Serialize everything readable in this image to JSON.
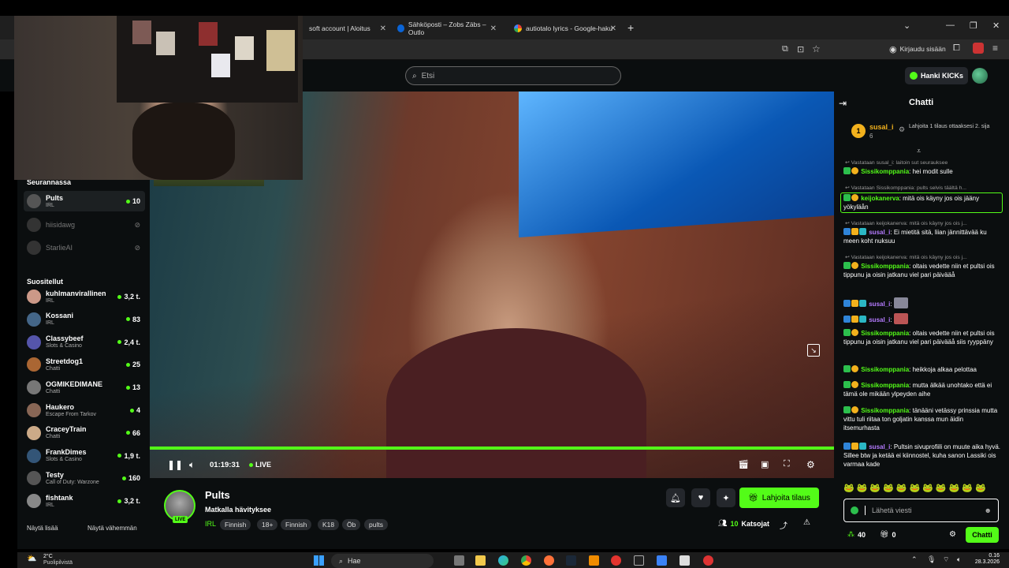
{
  "browser": {
    "tabs": [
      {
        "label": "soft account | Aloitus",
        "favicon_color": "#2b6cb0"
      },
      {
        "label": "Sähköposti – Zobs Zäbs – Outlo",
        "favicon_color": "#0a64d6"
      },
      {
        "label": "autiotalo lyrics - Google-haku",
        "favicon_color": "#ea4335"
      }
    ],
    "new_tab": "+",
    "controls": {
      "minimize": "—",
      "maximize": "❐",
      "close": "✕",
      "dropdown": "⌄"
    },
    "signin_label": "Kirjaudu sisään"
  },
  "header": {
    "search_placeholder": "Etsi",
    "kicks_button": "Hanki KICKs"
  },
  "sidebar": {
    "following_title": "Seurannassa",
    "following": [
      {
        "name": "Pults",
        "category": "IRL",
        "viewers": "10",
        "live": true
      },
      {
        "name": "hiisidawg",
        "category": "",
        "viewers": "",
        "live": false
      },
      {
        "name": "StarlieAI",
        "category": "",
        "viewers": "",
        "live": false
      }
    ],
    "recommended_title": "Suositellut",
    "recommended": [
      {
        "name": "kuhlmanvirallinen",
        "category": "IRL",
        "viewers": "3,2 t."
      },
      {
        "name": "Kossani",
        "category": "IRL",
        "viewers": "83"
      },
      {
        "name": "Classybeef",
        "category": "Slots & Casino",
        "viewers": "2,4 t."
      },
      {
        "name": "Streetdog1",
        "category": "Chatti",
        "viewers": "25"
      },
      {
        "name": "OGMIKEDIMANE",
        "category": "Chatti",
        "viewers": "13"
      },
      {
        "name": "Haukero",
        "category": "Escape From Tarkov",
        "viewers": "4"
      },
      {
        "name": "CraceyTrain",
        "category": "Chatti",
        "viewers": "66"
      },
      {
        "name": "FrankDimes",
        "category": "Slots & Casino",
        "viewers": "1,9 t."
      },
      {
        "name": "Testy",
        "category": "Call of Duty: Warzone",
        "viewers": "160"
      },
      {
        "name": "fishtank",
        "category": "IRL",
        "viewers": "3,2 t."
      }
    ],
    "show_more": "Näytä lisää",
    "show_less": "Näytä vähemmän"
  },
  "player": {
    "time": "01:19:31",
    "live_label": "LIVE"
  },
  "stream": {
    "channel": "Pults",
    "title": "Matkalla hävityksee",
    "live_badge": "LIVE",
    "category": "IRL",
    "tags": [
      "Finnish",
      "18+",
      "Finnish",
      "K18",
      "Öb",
      "pults"
    ],
    "gift_button": "Lahjoita tilaus",
    "viewers": "10",
    "viewers_label": "Katsojat"
  },
  "chat": {
    "title": "Chatti",
    "leader": {
      "name": "susal_i",
      "count": "6"
    },
    "gift_prompt": "Lahjoita 1 tilaus ottaaksesi 2. sija",
    "messages": [
      {
        "reply": "Vastataan susal_i: laitoin sut seurauksee",
        "user": "Sissikomppania",
        "text": ": hei modit sulle",
        "color": "green"
      },
      {
        "reply": "Vastataan Sissikomppania: pults selvis täältä h...",
        "user": "keijokanerva",
        "text": ": mitä ois käyny jos ois jääny yökyläån",
        "color": "green"
      },
      {
        "reply": "Vastataan keijokanerva: mitä ois käyny jos ois j...",
        "user": "susal_i",
        "text": ": Ei mietitä sitä, liian jännittävää ku meen koht nuksuu",
        "color": "purple"
      },
      {
        "reply": "Vastataan keijokanerva: mitä ois käyny jos ois j...",
        "user": "Sissikomppania",
        "text": ": oltais vedette niin et pultsi ois tippunu ja oisin jatkanu viel pari päivääå",
        "color": "green"
      },
      {
        "reply": "",
        "user": "susal_i",
        "text": ":",
        "color": "purple"
      },
      {
        "reply": "",
        "user": "susal_i",
        "text": ":",
        "color": "purple"
      },
      {
        "reply": "",
        "user": "Sissikomppania",
        "text": ": oltais vedette niin et pultsi ois tippunu ja oisin jatkanu viel pari päivääå siis ryyppäny",
        "color": "green"
      },
      {
        "reply": "",
        "user": "Sissikomppania",
        "text": ": heikkoja alkaa pelottaa",
        "color": "green"
      },
      {
        "reply": "",
        "user": "Sissikomppania",
        "text": ": mutta älkää unohtako että ei tämä ole mikään ylpeyden aihe",
        "color": "green"
      },
      {
        "reply": "",
        "user": "Sissikomppania",
        "text": ": tänääni vetässy prinssia mutta vittu tuli riitaa ton goljatin kanssa mun äidin itsemurhasta",
        "color": "green"
      },
      {
        "reply": "",
        "user": "susal_i",
        "text": ": Pultsin sivuprofiili on muute aika hyvä. Sillee btw ja ketää ei kiinnostel, kuha sanon Lassiki ois varmaa kade",
        "color": "purple"
      }
    ],
    "input_placeholder": "Lähetä viesti",
    "points": "40",
    "gifts": "0",
    "chat_button": "Chatti"
  },
  "taskbar": {
    "weather_temp": "2°C",
    "weather_text": "Puolipilvistä",
    "search": "Hae",
    "clock_time": "0.16",
    "clock_date": "28.3.2026"
  }
}
